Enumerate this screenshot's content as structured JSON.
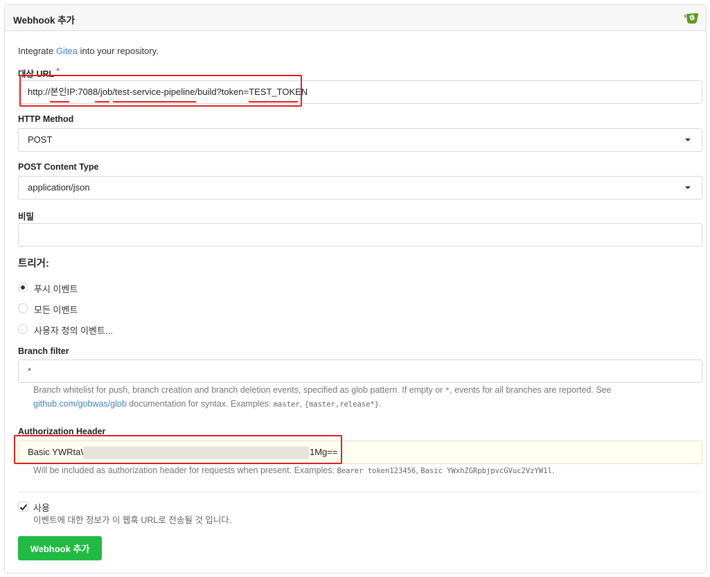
{
  "header": {
    "title": "Webhook 추가",
    "logo_icon": "gitea-logo-icon"
  },
  "intro": {
    "prefix": "Integrate ",
    "link": "Gitea",
    "suffix": " into your repository."
  },
  "target_url": {
    "label": "대상 URL",
    "required_mark": "*",
    "value_parts": [
      "http://",
      "본인",
      "IP:7088/",
      "job",
      "/",
      "test-service-pipeline",
      "/build?token=",
      "TEST_TOKEN"
    ]
  },
  "http_method": {
    "label": "HTTP Method",
    "selected": "POST"
  },
  "content_type": {
    "label": "POST Content Type",
    "selected": "application/json"
  },
  "secret": {
    "label": "비밀",
    "value": ""
  },
  "triggers": {
    "title": "트리거:",
    "options": [
      {
        "label": "푸시 이벤트",
        "checked": true
      },
      {
        "label": "모든 이벤트",
        "checked": false
      },
      {
        "label": "사용자 정의 이벤트...",
        "checked": false
      }
    ]
  },
  "branch_filter": {
    "label": "Branch filter",
    "value": "*",
    "help_line1": "Branch whitelist for push, branch creation and branch deletion events, specified as glob pattern. If empty or ",
    "help_code1": "*",
    "help_line1_end": ", events for all branches are reported. See",
    "help_link": "github.com/gobwas/glob",
    "help_line2": " documentation for syntax. Examples: ",
    "help_code2": "master",
    "help_sep": ", ",
    "help_code3": "{master,release*}",
    "help_end": "."
  },
  "auth_header": {
    "label": "Authorization Header",
    "value_prefix": "Basic YWRtaW",
    "value_suffix": "1Mg==",
    "help_text": "Will be included as authorization header for requests when present. Examples: ",
    "help_code1": "Bearer token123456",
    "help_sep": ", ",
    "help_code2": "Basic YWxhZGRpbjpvcGVuc2VzYW1l",
    "help_end": "."
  },
  "active": {
    "label": "사용",
    "checked": true,
    "help": "이벤트에 대한 정보가 이 웹훅 URL로 전송될 것 입니다."
  },
  "submit": {
    "label": "Webhook 추가"
  },
  "colors": {
    "primary_green": "#21ba45",
    "link_blue": "#4183c4",
    "annotation_red": "#e02020"
  }
}
